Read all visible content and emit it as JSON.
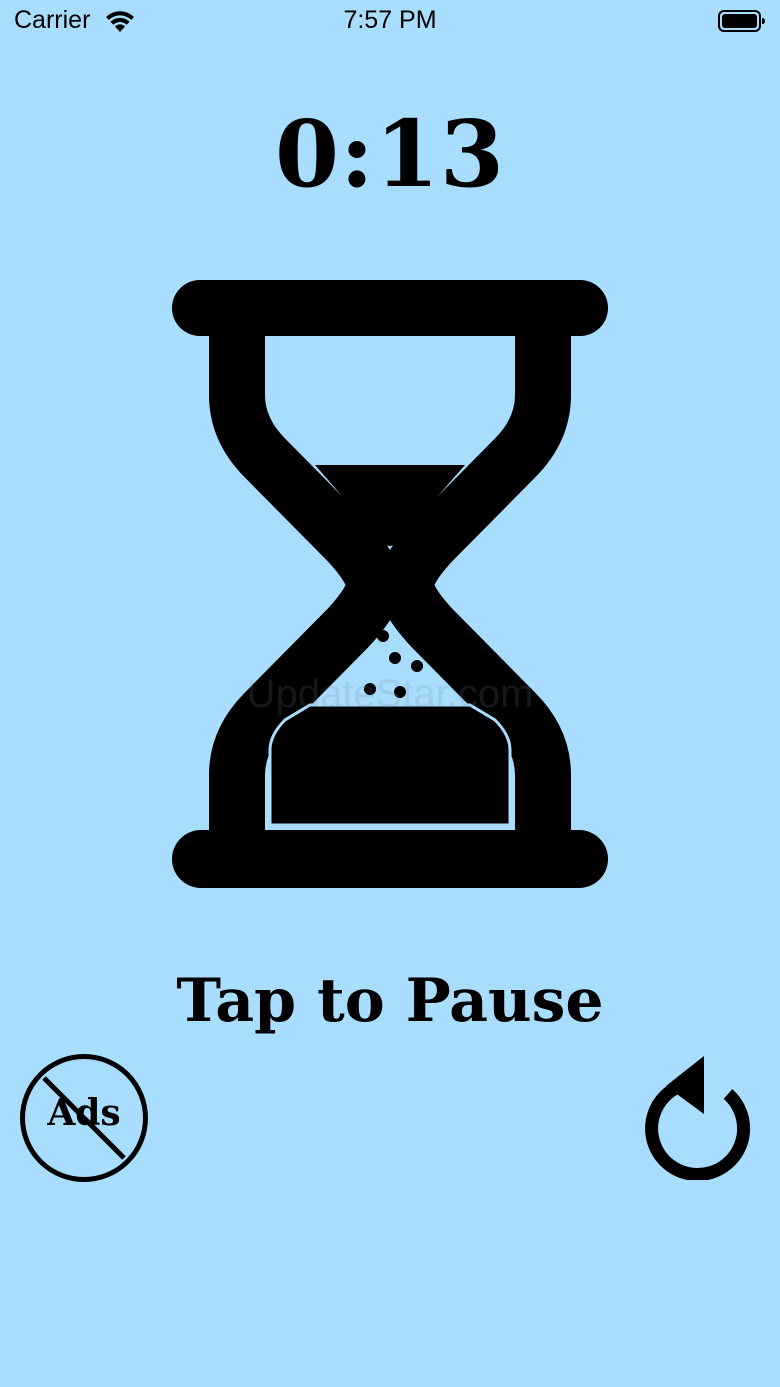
{
  "status_bar": {
    "carrier": "Carrier",
    "time": "7:57 PM",
    "icons": [
      "wifi-icon",
      "battery-icon"
    ]
  },
  "timer": {
    "display": "0:13"
  },
  "hourglass": {
    "icon": "hourglass-icon"
  },
  "watermark": "UpdateStar.com",
  "actions": {
    "tap_label": "Tap to Pause",
    "no_ads_label": "Ads",
    "no_ads_icon": "no-ads-icon",
    "reset_icon": "reset-icon"
  },
  "colors": {
    "background": "#A8DDFE",
    "foreground": "#000000"
  }
}
